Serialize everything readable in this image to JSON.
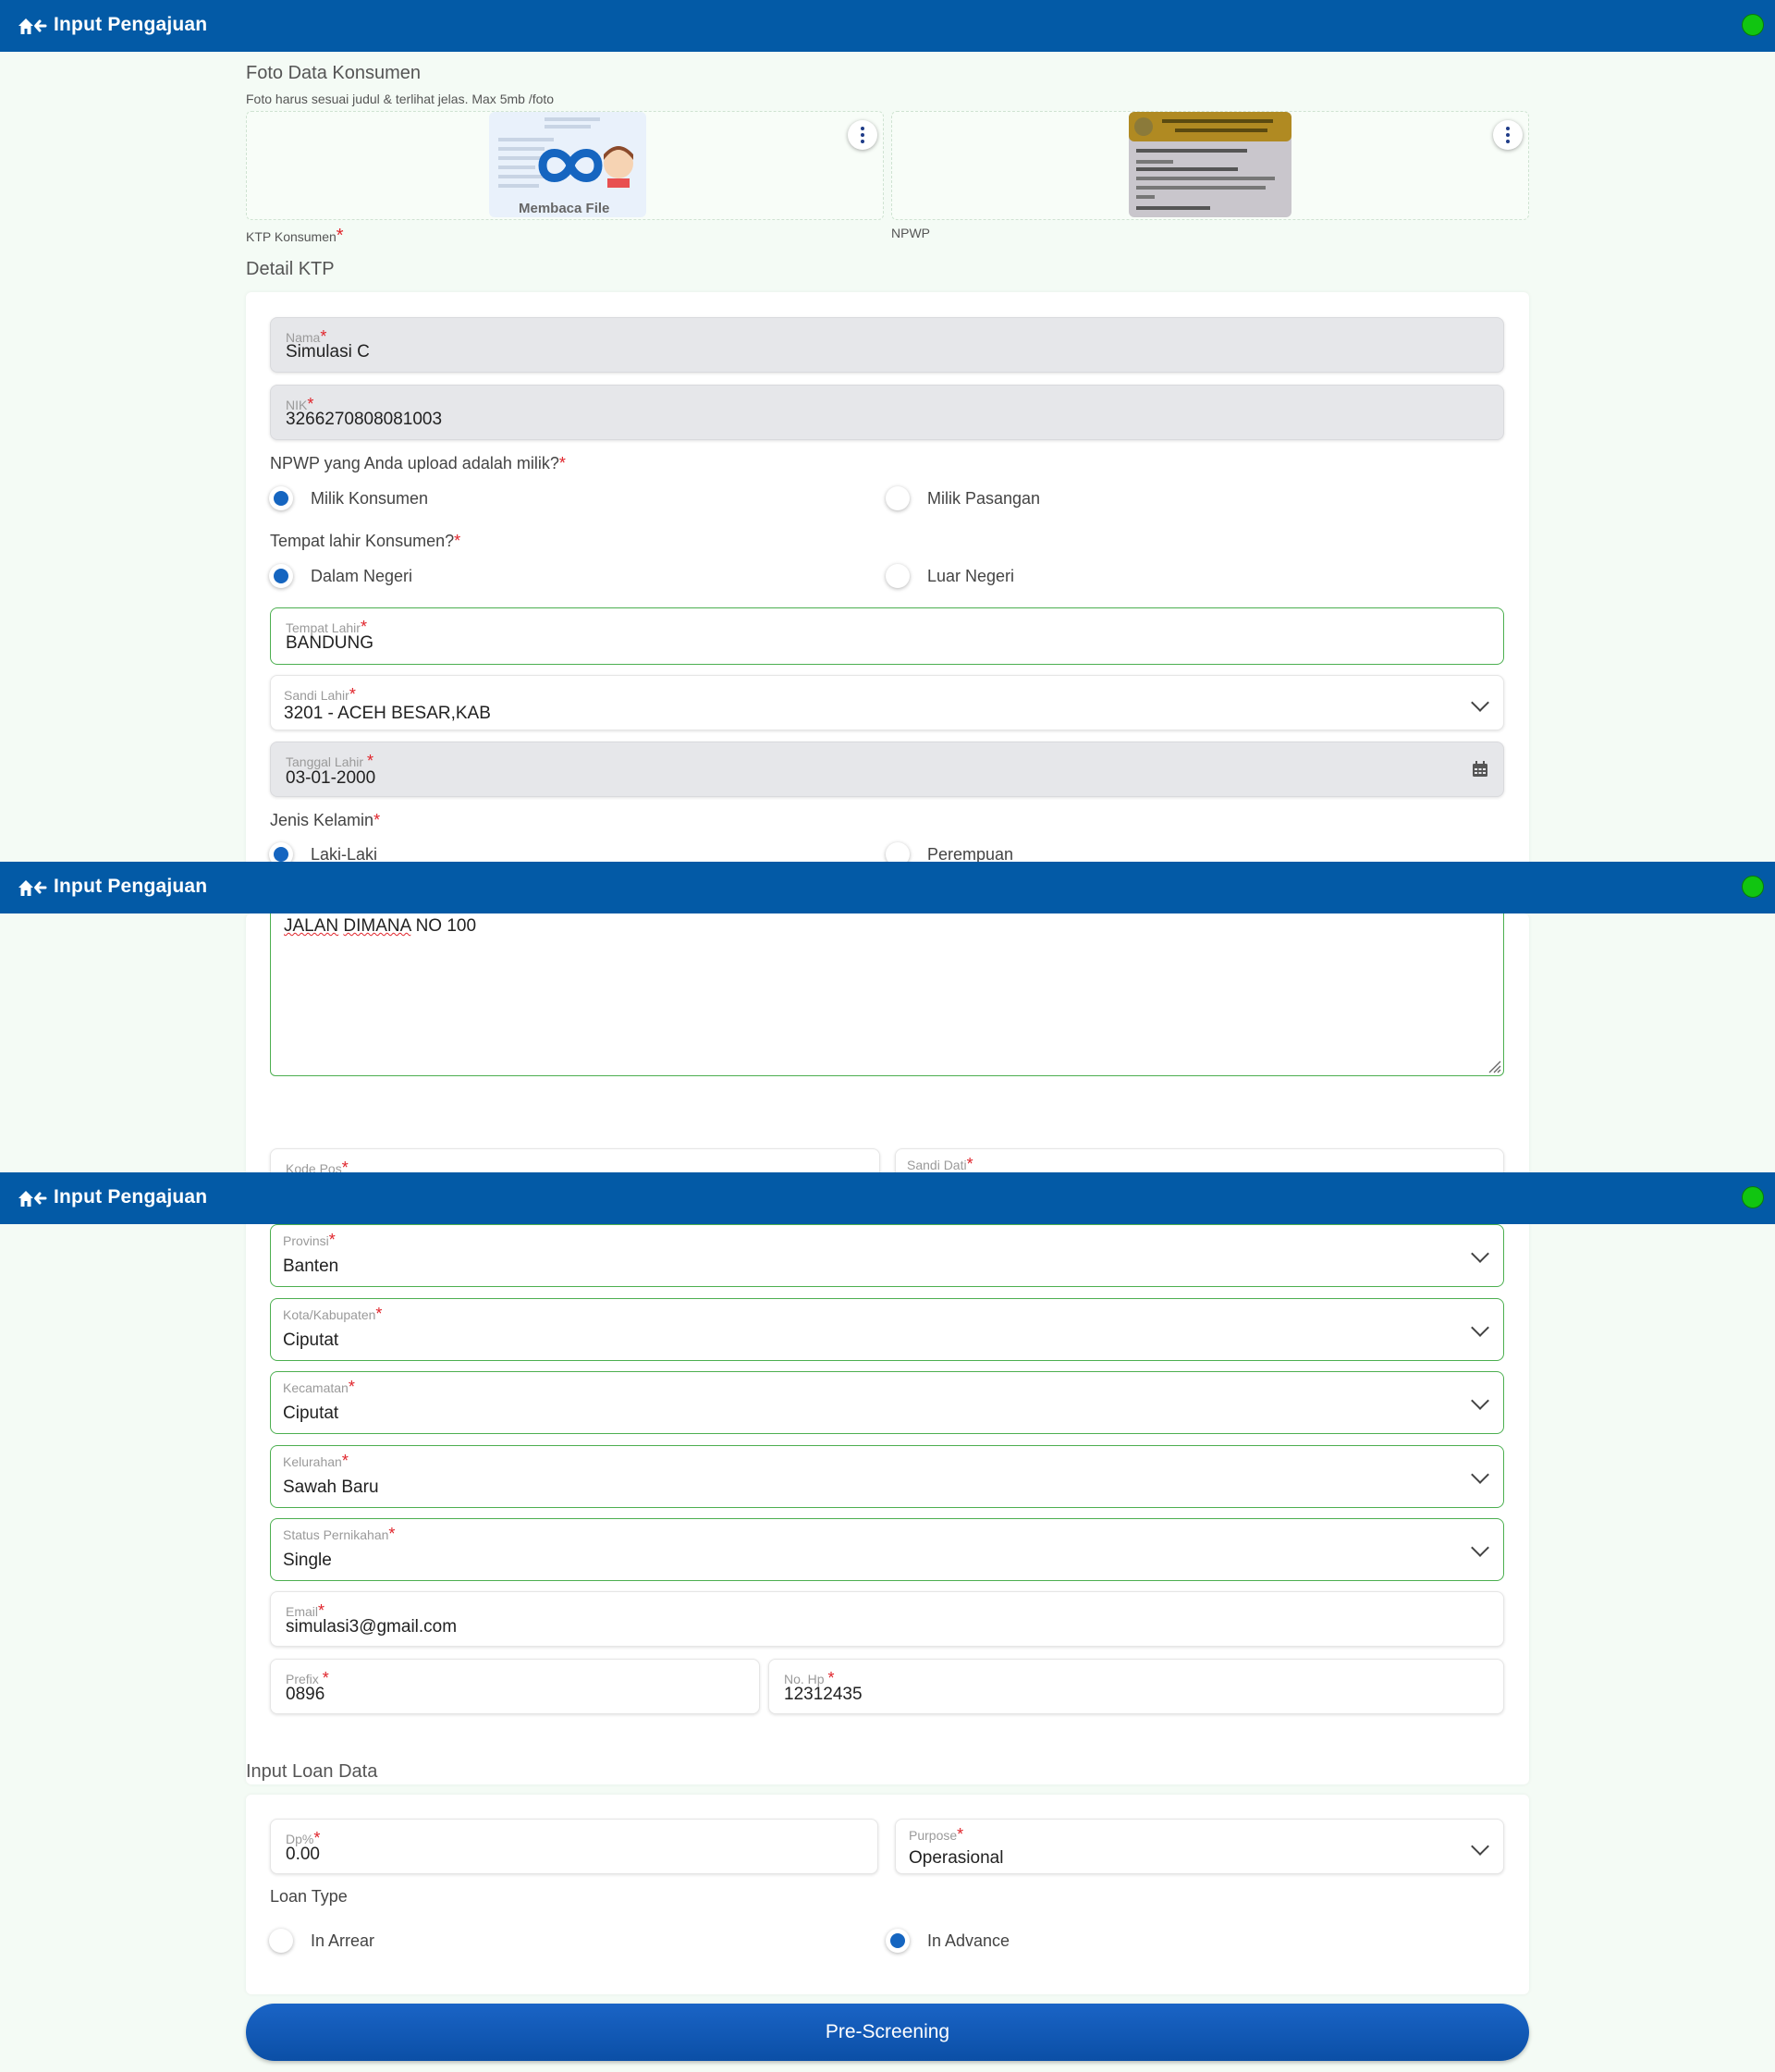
{
  "appbar": {
    "title": "Input Pengajuan"
  },
  "photos": {
    "section_title": "Foto Data Konsumen",
    "hint": "Foto harus sesuai judul & terlihat jelas. Max 5mb /foto",
    "ktp_label": "KTP Konsumen",
    "ktp_status": "Membaca File",
    "npwp_label": "NPWP"
  },
  "ktp_card_title": "Detail KTP",
  "fields": {
    "nama": {
      "label": "Nama",
      "value": "Simulasi C"
    },
    "nik": {
      "label": "NIK",
      "value": "3266270808081003"
    },
    "tempat_lahir": {
      "label": "Tempat Lahir",
      "value": "BANDUNG"
    },
    "sandi_lahir": {
      "label": "Sandi Lahir",
      "value": "3201 - ACEH BESAR,KAB"
    },
    "tanggal_lahir": {
      "label": "Tanggal Lahir",
      "value": "03-01-2000"
    },
    "alamat": {
      "value_word1": "JALAN",
      "value_word2": "DIMANA",
      "value_rest": "NO 100"
    },
    "kode_pos": {
      "label": "Kode Pos"
    },
    "sandi_dati": {
      "label": "Sandi Dati"
    },
    "provinsi": {
      "label": "Provinsi",
      "value": "Banten"
    },
    "kota": {
      "label": "Kota/Kabupaten",
      "value": "Ciputat"
    },
    "kecamatan": {
      "label": "Kecamatan",
      "value": "Ciputat"
    },
    "kelurahan": {
      "label": "Kelurahan",
      "value": "Sawah Baru"
    },
    "status": {
      "label": "Status Pernikahan",
      "value": "Single"
    },
    "email": {
      "label": "Email",
      "value": "simulasi3@gmail.com"
    },
    "prefix": {
      "label": "Prefix",
      "value": "0896"
    },
    "nohp": {
      "label": "No. Hp",
      "value": "12312435"
    }
  },
  "npwp_owner": {
    "question": "NPWP yang Anda upload adalah milik?",
    "options": [
      "Milik Konsumen",
      "Milik Pasangan"
    ],
    "selected": "Milik Konsumen"
  },
  "birthplace": {
    "question": "Tempat lahir Konsumen?",
    "options": [
      "Dalam Negeri",
      "Luar Negeri"
    ],
    "selected": "Dalam Negeri"
  },
  "gender": {
    "question": "Jenis Kelamin",
    "options": [
      "Laki-Laki",
      "Perempuan"
    ],
    "selected": "Laki-Laki"
  },
  "loan": {
    "section_title": "Input Loan Data",
    "dp": {
      "label": "Dp%",
      "value": "0.00"
    },
    "purpose": {
      "label": "Purpose",
      "value": "Operasional"
    },
    "loan_type_label": "Loan Type",
    "options": [
      "In Arrear",
      "In Advance"
    ],
    "selected": "In Advance"
  },
  "submit_label": "Pre-Screening",
  "colors": {
    "appbar": "#035aa6",
    "status_dot": "#11c511",
    "required": "#e0242b",
    "radio_on": "#1565c0",
    "focus_border": "#4caf50"
  }
}
